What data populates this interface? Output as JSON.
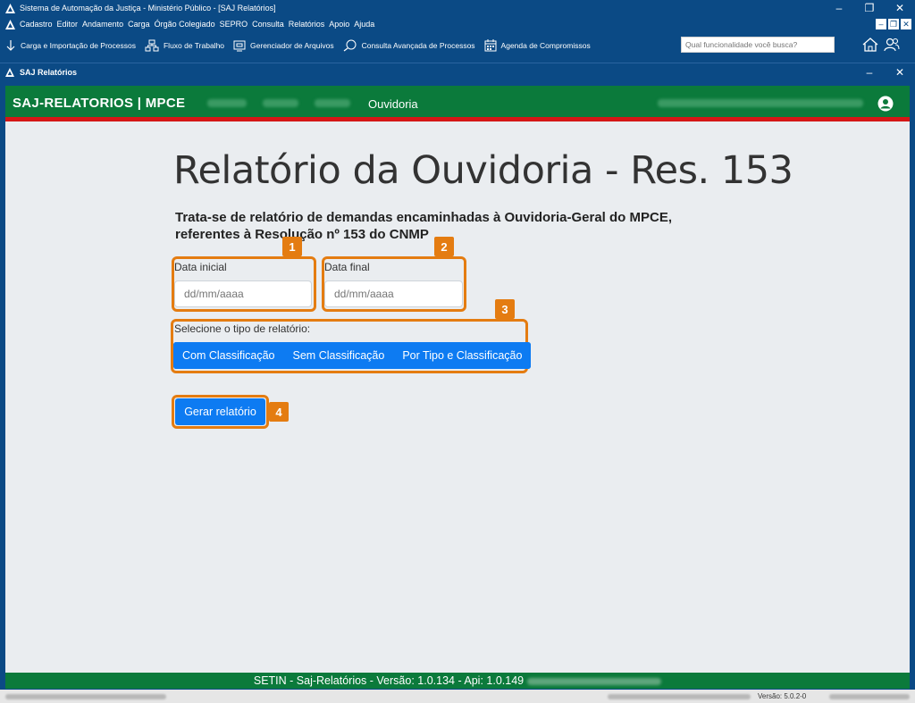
{
  "titlebar": {
    "title": "Sistema de Automação da Justiça - Ministério Público - [SAJ Relatórios]"
  },
  "menu": {
    "items": [
      "Cadastro",
      "Editor",
      "Andamento",
      "Carga",
      "Órgão Colegiado",
      "SEPRO",
      "Consulta",
      "Relatórios",
      "Apoio",
      "Ajuda"
    ]
  },
  "toolbar": {
    "items": [
      "Carga e Importação de Processos",
      "Fluxo de Trabalho",
      "Gerenciador de Arquivos",
      "Consulta Avançada de Processos",
      "Agenda de Compromissos"
    ],
    "search_placeholder": "Qual funcionalidade você busca?"
  },
  "inner": {
    "title": "SAJ Relatórios"
  },
  "nav": {
    "brand": "SAJ-RELATORIOS | MPCE",
    "active_link": "Ouvidoria"
  },
  "page": {
    "title": "Relatório da Ouvidoria - Res. 153",
    "description": "Trata-se de relatório de demandas encaminhadas à Ouvidoria-Geral do MPCE, referentes à Resolução nº 153 do CNMP",
    "start_label": "Data inicial",
    "start_placeholder": "dd/mm/aaaa",
    "end_label": "Data final",
    "end_placeholder": "dd/mm/aaaa",
    "type_label": "Selecione o tipo de relatório:",
    "type_options": [
      "Com Classificação",
      "Sem Classificação",
      "Por Tipo e Classificação"
    ],
    "generate_label": "Gerar relatório"
  },
  "badges": [
    "1",
    "2",
    "3",
    "4"
  ],
  "footer": {
    "text": "SETIN - Saj-Relatórios - Versão: 1.0.134 - Api: 1.0.149"
  },
  "status": {
    "version": "Versão: 5.0.2-0"
  },
  "colors": {
    "app_blue": "#0b4a85",
    "nav_green": "#0b7a3b",
    "accent_red": "#d41616",
    "highlight_orange": "#e47c11",
    "button_blue": "#0d7bf2"
  }
}
